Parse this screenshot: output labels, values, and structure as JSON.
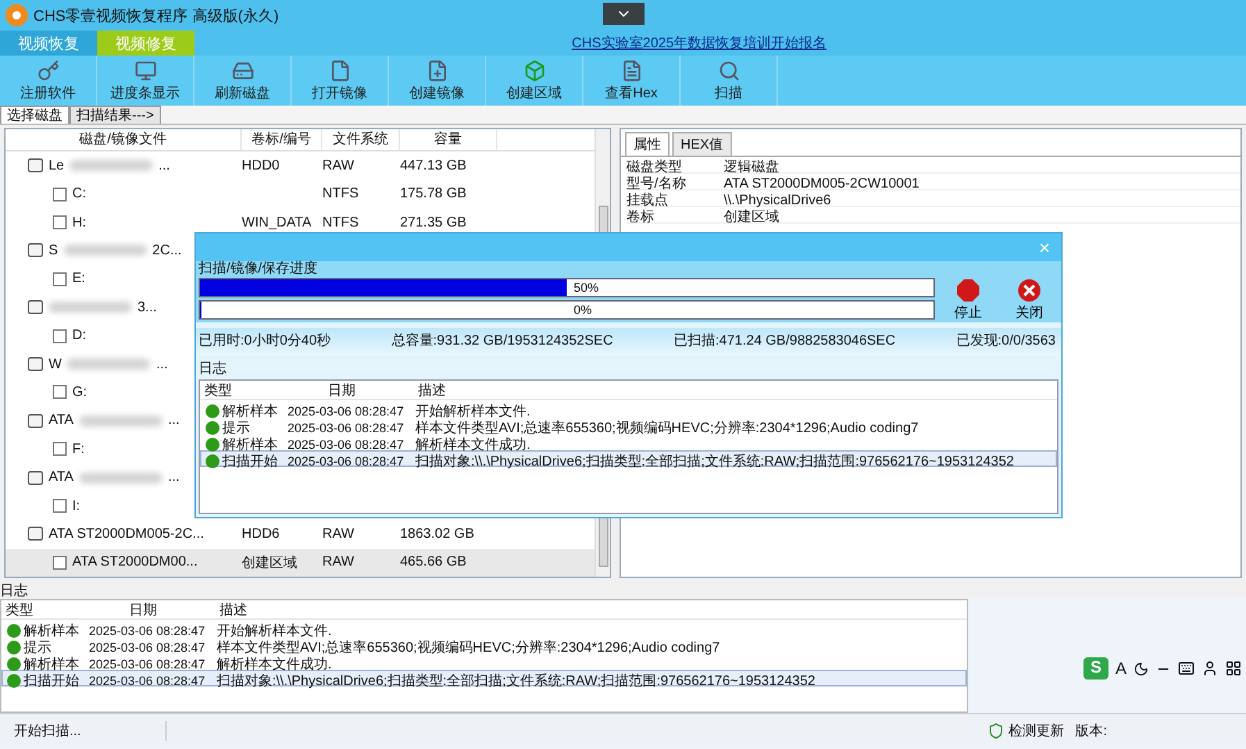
{
  "window": {
    "title": "CHS零壹视频恢复程序 高级版(永久)"
  },
  "main_tabs": [
    {
      "label": "视频恢复",
      "selected": false
    },
    {
      "label": "视频修复",
      "selected": true
    }
  ],
  "promo_link": "CHS实验室2025年数据恢复培训开始报名",
  "toolbar": [
    {
      "label": "注册软件",
      "kind": "key"
    },
    {
      "label": "进度条显示",
      "kind": "monitor"
    },
    {
      "label": "刷新磁盘",
      "kind": "disk"
    },
    {
      "label": "打开镜像",
      "kind": "file"
    },
    {
      "label": "创建镜像",
      "kind": "fileplus"
    },
    {
      "label": "创建区域",
      "kind": "block"
    },
    {
      "label": "查看Hex",
      "kind": "hex"
    },
    {
      "label": "扫描",
      "kind": "search"
    }
  ],
  "view_tabs": [
    {
      "label": "选择磁盘",
      "selected": true
    },
    {
      "label": "扫描结果--->",
      "selected": false
    }
  ],
  "disk_table": {
    "columns": [
      "磁盘/镜像文件",
      "卷标/编号",
      "文件系统",
      "容量"
    ],
    "rows": [
      {
        "name": "Le",
        "blurred": true,
        "tail": "...",
        "label": "HDD0",
        "fs": "RAW",
        "size": "447.13 GB",
        "selected": false,
        "children": [
          {
            "name": "C:",
            "fs": "NTFS",
            "size": "175.78 GB",
            "selected": false
          },
          {
            "name": "H:",
            "label": "WIN_DATA",
            "fs": "NTFS",
            "size": "271.35 GB",
            "selected": false
          }
        ]
      },
      {
        "name": "S",
        "blurred": true,
        "tail": "2C...",
        "selected": false,
        "children": [
          {
            "name": "E:",
            "selected": false
          }
        ]
      },
      {
        "blurred": true,
        "tail": "3...",
        "selected": false,
        "children": [
          {
            "name": "D:",
            "selected": false
          }
        ]
      },
      {
        "name": "W",
        "blurred": true,
        "tail": "...",
        "selected": false,
        "children": [
          {
            "name": "G:",
            "selected": false
          }
        ]
      },
      {
        "name": "ATA",
        "blurred": true,
        "tail": "...",
        "selected": false,
        "children": [
          {
            "name": "F:",
            "selected": false
          }
        ]
      },
      {
        "name": "ATA",
        "blurred": true,
        "tail": "...",
        "selected": false,
        "children": [
          {
            "name": "I:",
            "selected": false
          }
        ]
      },
      {
        "name": "ATA   ST2000DM005-2C...",
        "blurred": false,
        "label": "HDD6",
        "fs": "RAW",
        "size": "1863.02 GB",
        "selected": false,
        "children": [
          {
            "name": "ATA   ST2000DM00...",
            "label": "创建区域",
            "fs": "RAW",
            "size": "465.66 GB",
            "selected": true
          }
        ]
      }
    ]
  },
  "detail_tabs": [
    {
      "label": "属性",
      "selected": true
    },
    {
      "label": "HEX值",
      "selected": false
    }
  ],
  "properties": [
    {
      "key": "磁盘类型",
      "value": "逻辑磁盘"
    },
    {
      "key": "型号/名称",
      "value": "ATA    ST2000DM005-2CW10001"
    },
    {
      "key": "挂载点",
      "value": "\\\\.\\PhysicalDrive6"
    },
    {
      "key": "卷标",
      "value": "创建区域"
    }
  ],
  "dialog": {
    "close": "×",
    "section": "扫描/镜像/保存进度",
    "progress": [
      {
        "reading": "50%",
        "level": 0.5
      },
      {
        "reading": "0%",
        "level": 0
      }
    ],
    "buttons": [
      {
        "label": "停止",
        "kind": "stop"
      },
      {
        "label": "关闭",
        "kind": "close"
      }
    ],
    "stats": [
      "已用时:0小时0分40秒",
      "总容量:931.32 GB/1953124352SEC",
      "已扫描:471.24 GB/9882583046SEC",
      "已发现:0/0/3563"
    ],
    "log_title": "日志",
    "log": {
      "columns": [
        "类型",
        "日期",
        "描述"
      ],
      "rows": [
        {
          "type": "解析样本",
          "date": "2025-03-06 08:28:47",
          "desc": "开始解析样本文件.",
          "selected": false
        },
        {
          "type": "提示",
          "date": "2025-03-06 08:28:47",
          "desc": "样本文件类型AVI;总速率655360;视频编码HEVC;分辨率:2304*1296;Audio coding7",
          "selected": false
        },
        {
          "type": "解析样本",
          "date": "2025-03-06 08:28:47",
          "desc": "解析样本文件成功.",
          "selected": false
        },
        {
          "type": "扫描开始",
          "date": "2025-03-06 08:28:47",
          "desc": "扫描对象:\\\\.\\PhysicalDrive6;扫描类型:全部扫描;文件系统:RAW;扫描范围:976562176~1953124352",
          "selected": true
        }
      ]
    }
  },
  "log_title": "日志",
  "log": {
    "columns": [
      "类型",
      "日期",
      "描述"
    ],
    "rows": [
      {
        "type": "解析样本",
        "date": "2025-03-06 08:28:47",
        "desc": "开始解析样本文件.",
        "selected": false
      },
      {
        "type": "提示",
        "date": "2025-03-06 08:28:47",
        "desc": "样本文件类型AVI;总速率655360;视频编码HEVC;分辨率:2304*1296;Audio coding7",
        "selected": false
      },
      {
        "type": "解析样本",
        "date": "2025-03-06 08:28:47",
        "desc": "解析样本文件成功.",
        "selected": false
      },
      {
        "type": "扫描开始",
        "date": "2025-03-06 08:28:47",
        "desc": "扫描对象:\\\\.\\PhysicalDrive6;扫描类型:全部扫描;文件系统:RAW;扫描范围:976562176~1953124352",
        "selected": true
      }
    ]
  },
  "ime_toolbar": [
    {
      "text": "S",
      "kind": "logo"
    },
    {
      "text": "A",
      "kind": "letter"
    },
    {
      "kind": "moon"
    },
    {
      "kind": "punct"
    },
    {
      "kind": "keyboard"
    },
    {
      "kind": "user"
    },
    {
      "kind": "grid"
    }
  ],
  "status_bar": {
    "message": "开始扫描...",
    "update": "检测更新",
    "version_label": "版本:"
  }
}
